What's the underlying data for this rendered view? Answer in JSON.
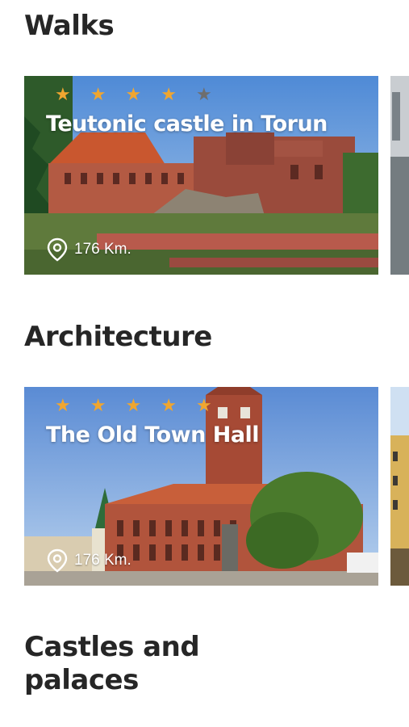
{
  "sections": [
    {
      "title": "Walks",
      "card": {
        "title": "Teutonic castle in Torun",
        "rating": 4,
        "max_rating": 5,
        "distance": "176 Km."
      }
    },
    {
      "title": "Architecture",
      "card": {
        "title": "The Old Town Hall",
        "rating": 5,
        "max_rating": 5,
        "distance": "176 Km."
      }
    },
    {
      "title": "Castles and palaces"
    }
  ],
  "icons": {
    "star": "star-icon",
    "location": "location-pin-icon"
  },
  "colors": {
    "star_filled": "#f0a630",
    "star_empty": "#6e6e6e",
    "heading": "#262626"
  }
}
